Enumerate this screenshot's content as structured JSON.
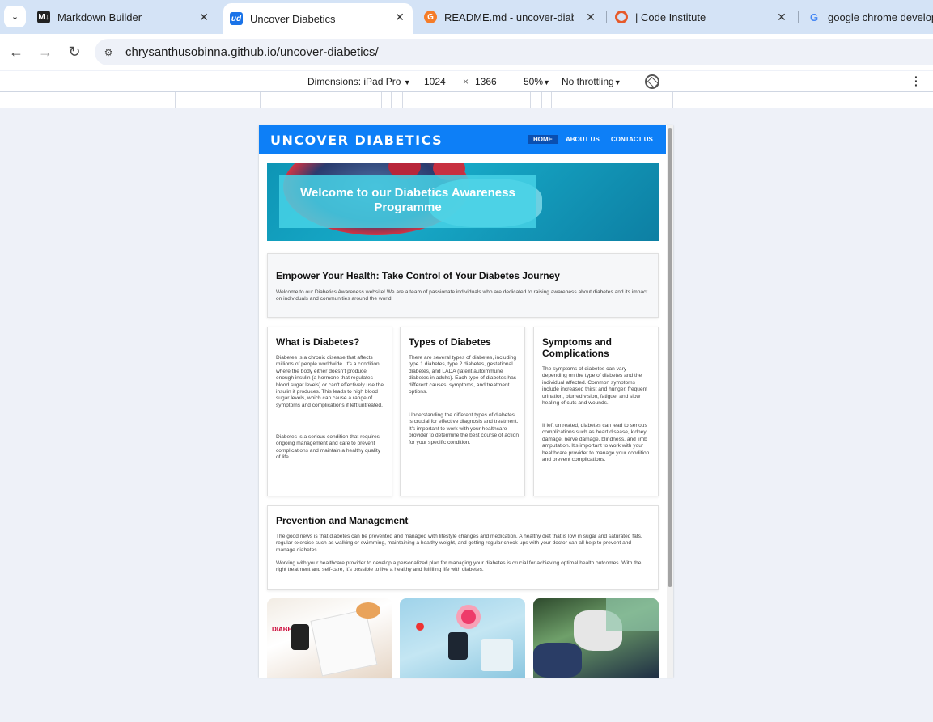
{
  "browser": {
    "tabs": [
      {
        "title": "Markdown Builder",
        "favicon": "M↓"
      },
      {
        "title": "Uncover Diabetics",
        "favicon": "ud",
        "active": true
      },
      {
        "title": "README.md - uncover-diabetic",
        "favicon": "G"
      },
      {
        "title": "| Code Institute",
        "favicon": "O"
      },
      {
        "title": "google chrome develope",
        "favicon": "G"
      }
    ],
    "url": "chrysanthusobinna.github.io/uncover-diabetics/"
  },
  "devtools": {
    "dimensions_label": "Dimensions: iPad Pro",
    "width": "1024",
    "times": "×",
    "height": "1366",
    "zoom": "50%",
    "throttling": "No throttling"
  },
  "site": {
    "logo": "UNCOVER DIABETICS",
    "nav": [
      "HOME",
      "ABOUT US",
      "CONTACT US"
    ],
    "hero_title": "Welcome to our Diabetics Awareness Programme",
    "intro": {
      "heading": "Empower Your Health: Take Control of Your Diabetes Journey",
      "text": "Welcome to our Diabetics Awareness website! We are a team of passionate individuals who are dedicated to raising awareness about diabetes and its impact on individuals and communities around the world."
    },
    "cards": [
      {
        "heading": "What is Diabetes?",
        "p1": "Diabetes is a chronic disease that affects millions of people worldwide. It's a condition where the body either doesn't produce enough insulin (a hormone that regulates blood sugar levels) or can't effectively use the insulin it produces. This leads to high blood sugar levels, which can cause a range of symptoms and complications if left untreated.",
        "p2": "Diabetes is a serious condition that requires ongoing management and care to prevent complications and maintain a healthy quality of life."
      },
      {
        "heading": "Types of Diabetes",
        "p1": "There are several types of diabetes, including type 1 diabetes, type 2 diabetes, gestational diabetes, and LADA (latent autoimmune diabetes in adults). Each type of diabetes has different causes, symptoms, and treatment options.",
        "p2": "Understanding the different types of diabetes is crucial for effective diagnosis and treatment. It's important to work with your healthcare provider to determine the best course of action for your specific condition."
      },
      {
        "heading": "Symptoms and Complications",
        "p1": "The symptoms of diabetes can vary depending on the type of diabetes and the individual affected. Common symptoms include increased thirst and hunger, frequent urination, blurred vision, fatigue, and slow healing of cuts and wounds.",
        "p2": "If left untreated, diabetes can lead to serious complications such as heart disease, kidney damage, nerve damage, blindness, and limb amputation. It's important to work with your healthcare provider to manage your condition and prevent complications."
      }
    ],
    "prevention": {
      "heading": "Prevention and Management",
      "p1": "The good news is that diabetes can be prevented and managed with lifestyle changes and medication. A healthy diet that is low in sugar and saturated fats, regular exercise such as walking or swimming, maintaining a healthy weight, and getting regular check-ups with your doctor can all help to prevent and manage diabetes.",
      "p2": "Working with your healthcare provider to develop a personalized plan for managing your diabetes is crucial for achieving optimal health outcomes. With the right treatment and self-care, it's possible to live a healthy and fulfilling life with diabetes."
    },
    "photo1_text": "DIABE"
  }
}
